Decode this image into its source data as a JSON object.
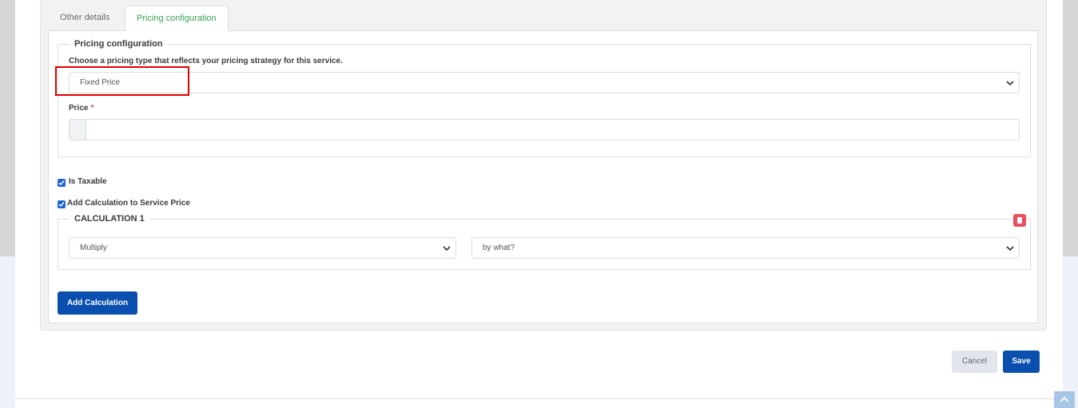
{
  "tabs": [
    {
      "label": "Other details"
    },
    {
      "label": "Pricing configuration"
    }
  ],
  "pricing": {
    "legend": "Pricing configuration",
    "help_text": "Choose a pricing type that reflects your pricing strategy for this service.",
    "type_value": "Fixed Price",
    "price_label": "Price",
    "price_required": "*",
    "price_value": ""
  },
  "options": {
    "is_taxable_label": "Is Taxable",
    "is_taxable_checked": true,
    "add_calc_label": "Add Calculation to Service Price",
    "add_calc_checked": true
  },
  "calculation": {
    "legend": "CALCULATION 1",
    "operation_value": "Multiply",
    "operand_placeholder": "by what?"
  },
  "buttons": {
    "add_calculation": "Add Calculation",
    "cancel": "Cancel",
    "save": "Save"
  },
  "icons": {
    "select_chevron": "chevron-down-icon",
    "checkbox_check": "check-icon",
    "delete_calc": "trash-icon",
    "scroll_top": "chevron-up-icon"
  },
  "colors": {
    "primary": "#0a4fae",
    "active_tab": "#3aa05a",
    "checkbox": "#1b64d6",
    "delete": "#e9505f",
    "highlight": "#e00000",
    "required": "#e04545"
  }
}
